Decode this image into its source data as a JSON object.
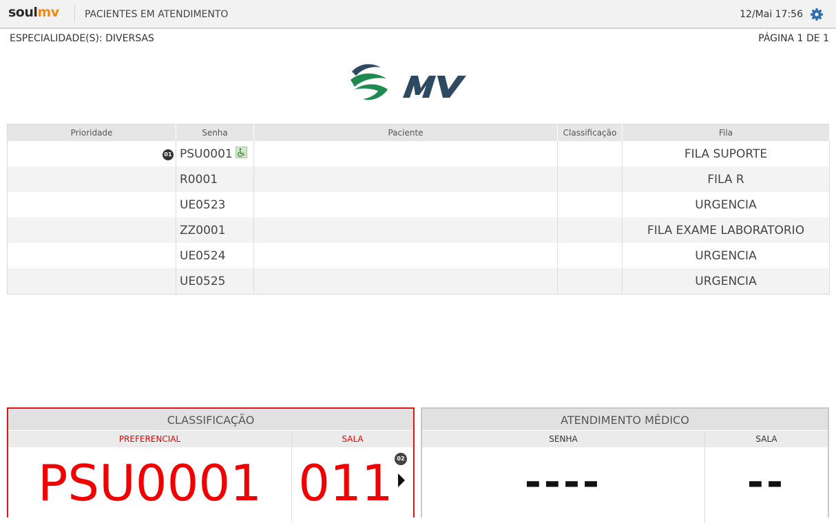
{
  "header": {
    "logo_soul": "soul",
    "logo_mv": "mv",
    "title": "PACIENTES EM ATENDIMENTO",
    "datetime": "12/Mai 17:56",
    "settings_icon": "gear-icon"
  },
  "info": {
    "specialty": "ESPECIALIDADE(S):  DIVERSAS",
    "page": "PÁGINA 1 DE 1"
  },
  "colors": {
    "accent_red": "#f00000",
    "logo_orange": "#f08a12",
    "mv_green": "#1e8a50",
    "mv_navy": "#2e4a62"
  },
  "table": {
    "columns": [
      "Prioridade",
      "Senha",
      "Paciente",
      "Classificação",
      "Fila"
    ],
    "rows": [
      {
        "priority": "",
        "priority_badge": "01",
        "senha": "PSU0001",
        "accessibility_icon": "wheelchair-icon",
        "paciente": "",
        "classificacao": "",
        "fila": "FILA SUPORTE"
      },
      {
        "priority": "",
        "senha": "R0001",
        "paciente": "",
        "classificacao": "",
        "fila": "FILA R"
      },
      {
        "priority": "",
        "senha": "UE0523",
        "paciente": "",
        "classificacao": "",
        "fila": "URGENCIA"
      },
      {
        "priority": "",
        "senha": "ZZ0001",
        "paciente": "",
        "classificacao": "",
        "fila": "FILA EXAME LABORATORIO"
      },
      {
        "priority": "",
        "senha": "UE0524",
        "paciente": "",
        "classificacao": "",
        "fila": "URGENCIA"
      },
      {
        "priority": "",
        "senha": "UE0525",
        "paciente": "",
        "classificacao": "",
        "fila": "URGENCIA"
      }
    ]
  },
  "panels": {
    "classificacao": {
      "title": "CLASSIFICAÇÃO",
      "col1_label": "PREFERENCIAL",
      "col2_label": "SALA",
      "senha": "PSU0001",
      "sala": "011",
      "badge": "02"
    },
    "atendimento": {
      "title": "ATENDIMENTO MÉDICO",
      "col1_label": "SENHA",
      "col2_label": "SALA",
      "senha": "----",
      "sala": "--"
    }
  }
}
